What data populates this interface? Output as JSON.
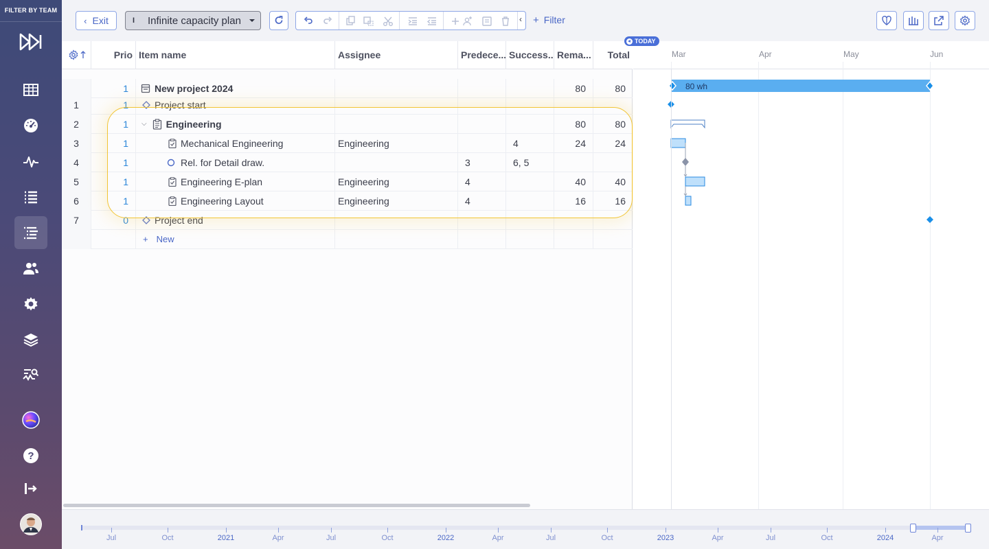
{
  "sidebar": {
    "filter_by_team": "FILTER BY TEAM",
    "items": [
      {
        "icon": "fast-forward-logo-icon"
      },
      {
        "icon": "grid-table-icon"
      },
      {
        "icon": "dashboard-gauge-icon"
      },
      {
        "icon": "activity-pulse-icon"
      },
      {
        "icon": "list-icon"
      },
      {
        "icon": "gantt-list-icon",
        "active": true
      },
      {
        "icon": "users-icon"
      },
      {
        "icon": "gear-icon"
      },
      {
        "icon": "layers-icon"
      },
      {
        "icon": "analytics-search-icon"
      },
      {
        "icon": "app-orb-icon"
      },
      {
        "icon": "help-icon"
      },
      {
        "icon": "logout-icon"
      },
      {
        "icon": "user-avatar"
      }
    ]
  },
  "toolbar": {
    "exit_label": "Exit",
    "plan_name": "Infinite capacity plan",
    "filter_label": "Filter"
  },
  "grid": {
    "columns": [
      "Prio",
      "Item name",
      "Assignee",
      "Predece...",
      "Success...",
      "Rema...",
      "Total"
    ],
    "rows": [
      {
        "idx": "",
        "prio": "1",
        "name": "New project 2024",
        "type": "project",
        "assignee": "",
        "pred": "",
        "succ": "",
        "remaining": "80",
        "total": "80"
      },
      {
        "idx": "1",
        "prio": "1",
        "name": "Project start",
        "type": "milestone",
        "assignee": "",
        "pred": "",
        "succ": "",
        "remaining": "",
        "total": ""
      },
      {
        "idx": "2",
        "prio": "1",
        "name": "Engineering",
        "type": "group",
        "assignee": "",
        "pred": "",
        "succ": "",
        "remaining": "80",
        "total": "80"
      },
      {
        "idx": "3",
        "prio": "1",
        "name": "Mechanical Engineering",
        "type": "task",
        "assignee": "Engineering",
        "pred": "",
        "succ": "4",
        "remaining": "24",
        "total": "24"
      },
      {
        "idx": "4",
        "prio": "1",
        "name": "Rel. for Detail draw.",
        "type": "checkpoint",
        "assignee": "",
        "pred": "3",
        "succ": "6, 5",
        "remaining": "",
        "total": ""
      },
      {
        "idx": "5",
        "prio": "1",
        "name": "Engineering E-plan",
        "type": "task",
        "assignee": "Engineering",
        "pred": "4",
        "succ": "",
        "remaining": "40",
        "total": "40"
      },
      {
        "idx": "6",
        "prio": "1",
        "name": "Engineering Layout",
        "type": "task",
        "assignee": "Engineering",
        "pred": "4",
        "succ": "",
        "remaining": "16",
        "total": "16"
      },
      {
        "idx": "7",
        "prio": "0",
        "name": "Project end",
        "type": "milestone",
        "assignee": "",
        "pred": "",
        "succ": "",
        "remaining": "",
        "total": ""
      }
    ],
    "new_label": "New"
  },
  "gantt": {
    "today_label": "TODAY",
    "months": [
      "Mar",
      "Apr",
      "May",
      "Jun"
    ],
    "project_bar_label": "80 wh"
  },
  "timeline": {
    "labels": [
      "Jul",
      "Oct",
      "2021",
      "Apr",
      "Jul",
      "Oct",
      "2022",
      "Apr",
      "Jul",
      "Oct",
      "2023",
      "Apr",
      "Jul",
      "Oct",
      "2024",
      "Apr"
    ]
  },
  "colors": {
    "accent": "#4a67c6",
    "bar_blue": "#5aaef0",
    "highlight": "#f1c433"
  }
}
